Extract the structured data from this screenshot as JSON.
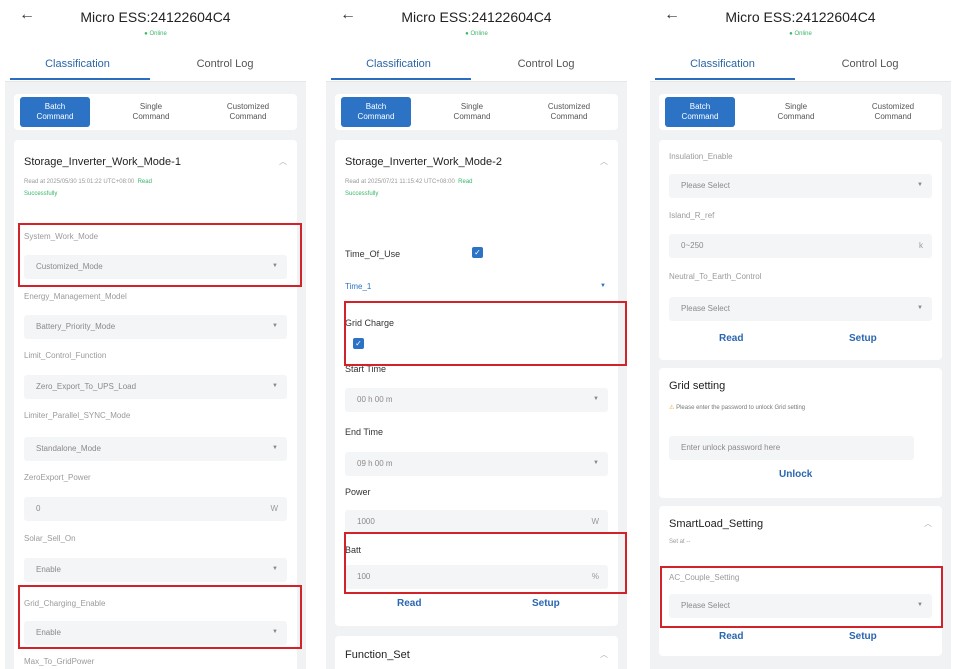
{
  "screens": [
    {
      "back_icon": "arrow-left-icon",
      "title": "Micro ESS:24122604C4",
      "status": "● Online",
      "tabs": [
        "Classification",
        "Control Log"
      ],
      "segments": [
        "Batch\nCommand",
        "Single\nCommand",
        "Customized\nCommand"
      ],
      "card": {
        "title": "Storage_Inverter_Work_Mode-1",
        "read_info": "Read at 2025/05/30 15:01:22 UTC+08:00",
        "read_result_a": "Read",
        "read_result_b": "Successfully",
        "fields": [
          {
            "label": "System_Work_Mode",
            "value": "Customized_Mode"
          },
          {
            "label": "Energy_Management_Model",
            "value": "Battery_Priority_Mode"
          },
          {
            "label": "Limit_Control_Function",
            "value": "Zero_Export_To_UPS_Load"
          },
          {
            "label": "Limiter_Parallel_SYNC_Mode",
            "value": "Standalone_Mode"
          },
          {
            "label": "ZeroExport_Power",
            "value": "0",
            "unit": "W"
          },
          {
            "label": "Solar_Sell_On",
            "value": "Enable"
          },
          {
            "label": "Grid_Charging_Enable",
            "value": "Enable"
          },
          {
            "label": "Max_To_GridPower"
          }
        ]
      }
    },
    {
      "back_icon": "arrow-left-icon",
      "title": "Micro ESS:24122604C4",
      "status": "● Online",
      "tabs": [
        "Classification",
        "Control Log"
      ],
      "segments": [
        "Batch\nCommand",
        "Single\nCommand",
        "Customized\nCommand"
      ],
      "card": {
        "title": "Storage_Inverter_Work_Mode-2",
        "read_info": "Read at 2025/07/21 11:15:42 UTC+08:00",
        "read_result_a": "Read",
        "read_result_b": "Successfully",
        "time_of_use_label": "Time_Of_Use",
        "time_slot": "Time_1",
        "grid_charge_label": "Grid Charge",
        "start_time_label": "Start Time",
        "start_time_value": "00 h 00 m",
        "end_time_label": "End Time",
        "end_time_value": "09 h 00 m",
        "power_label": "Power",
        "power_value": "1000",
        "power_unit": "W",
        "batt_label": "Batt",
        "batt_value": "100",
        "batt_unit": "%",
        "read_button": "Read",
        "setup_button": "Setup"
      },
      "next_card_title": "Function_Set"
    },
    {
      "back_icon": "arrow-left-icon",
      "title": "Micro ESS:24122604C4",
      "status": "● Online",
      "tabs": [
        "Classification",
        "Control Log"
      ],
      "segments": [
        "Batch\nCommand",
        "Single\nCommand",
        "Customized\nCommand"
      ],
      "card1": {
        "fields": [
          {
            "label": "Insulation_Enable",
            "value": "Please Select"
          },
          {
            "label": "Island_R_ref",
            "value": "0~250",
            "unit": "k"
          },
          {
            "label": "Neutral_To_Earth_Control",
            "value": "Please Select"
          }
        ],
        "read_button": "Read",
        "setup_button": "Setup"
      },
      "card2": {
        "title": "Grid setting",
        "note": "Please enter the password to unlock Grid setting",
        "password_placeholder": "Enter unlock password here",
        "unlock_button": "Unlock"
      },
      "card3": {
        "title": "SmartLoad_Setting",
        "set_at": "Set at --",
        "field_label": "AC_Couple_Setting",
        "field_value": "Please Select",
        "read_button": "Read",
        "setup_button": "Setup"
      }
    }
  ],
  "colors": {
    "accent": "#2c73c6",
    "highlight": "#d2232a",
    "success": "#39b56a"
  }
}
